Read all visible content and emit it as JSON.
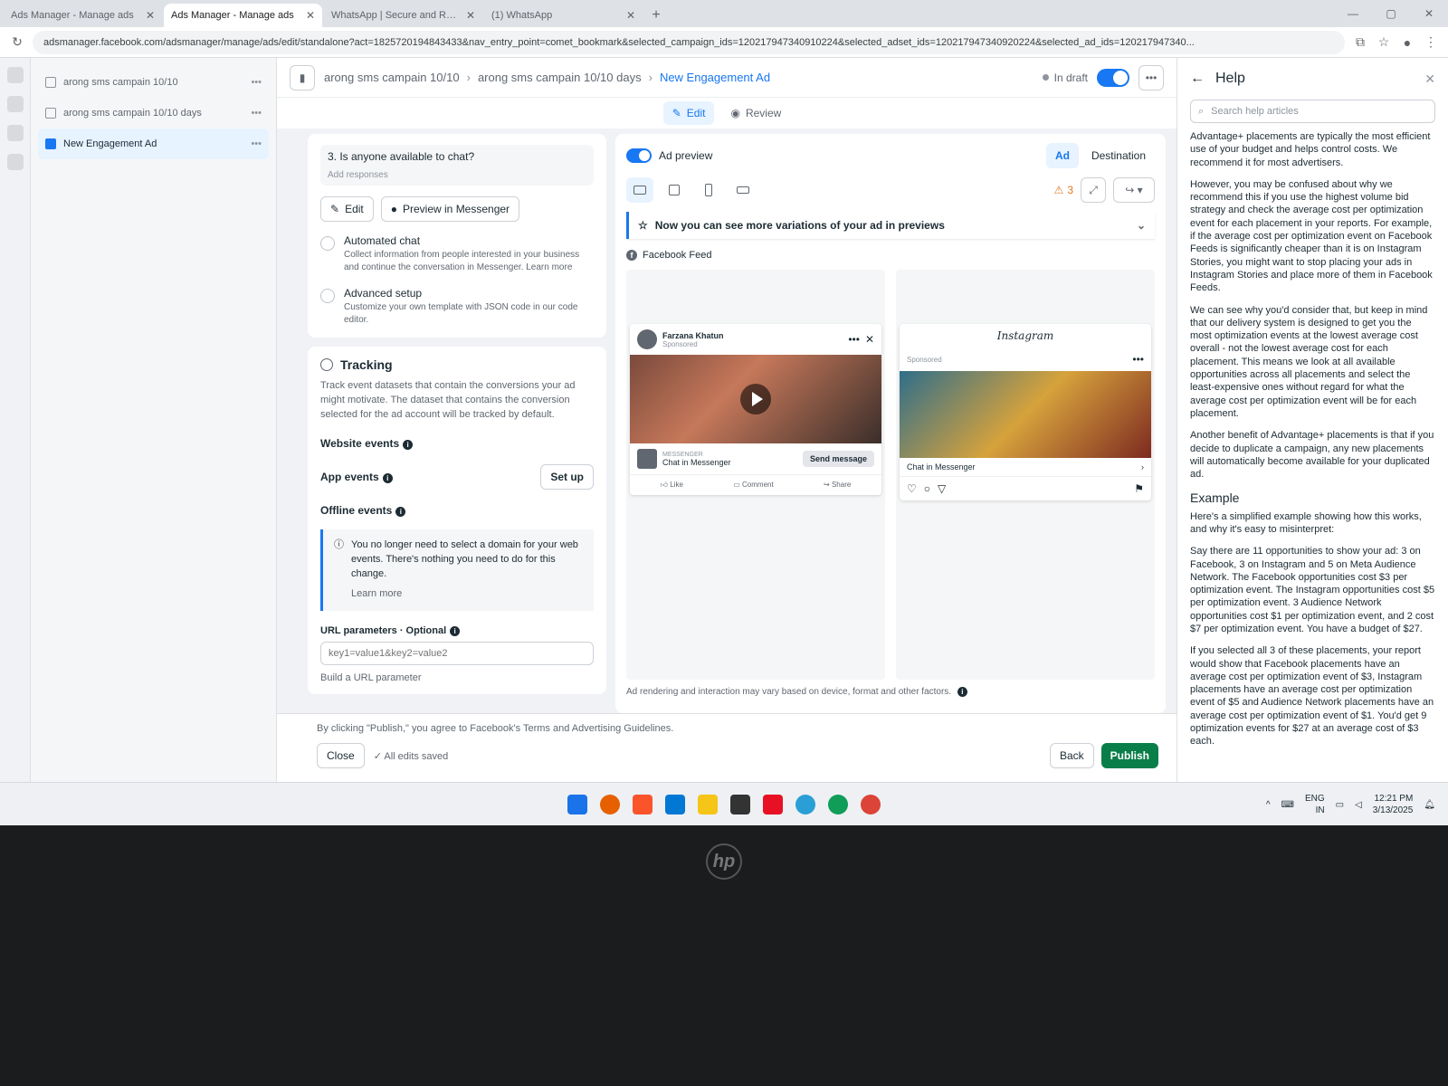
{
  "browser": {
    "tabs": [
      {
        "title": "Ads Manager - Manage ads"
      },
      {
        "title": "Ads Manager - Manage ads"
      },
      {
        "title": "WhatsApp | Secure and Reliab"
      },
      {
        "title": "(1) WhatsApp"
      }
    ],
    "url": "adsmanager.facebook.com/adsmanager/manage/ads/edit/standalone?act=1825720194843433&nav_entry_point=comet_bookmark&selected_campaign_ids=120217947340910224&selected_adset_ids=120217947340920224&selected_ad_ids=120217947340..."
  },
  "tree": {
    "items": [
      {
        "label": "arong sms campain 10/10"
      },
      {
        "label": "arong sms campain 10/10 days"
      },
      {
        "label": "New Engagement Ad"
      }
    ]
  },
  "breadcrumb": {
    "campaign": "arong sms campain 10/10",
    "adset": "arong sms campain 10/10 days",
    "ad": "New Engagement Ad"
  },
  "status": {
    "draft": "In draft"
  },
  "modes": {
    "edit": "Edit",
    "review": "Review"
  },
  "chat": {
    "question": "3. Is anyone available to chat?",
    "add_responses": "Add responses",
    "edit_btn": "Edit",
    "preview_btn": "Preview in Messenger",
    "automated_title": "Automated chat",
    "automated_desc": "Collect information from people interested in your business and continue the conversation in Messenger. Learn more",
    "advanced_title": "Advanced setup",
    "advanced_desc": "Customize your own template with JSON code in our code editor."
  },
  "tracking": {
    "title": "Tracking",
    "desc": "Track event datasets that contain the conversions your ad might motivate. The dataset that contains the conversion selected for the ad account will be tracked by default.",
    "website_events": "Website events",
    "app_events": "App events",
    "setup_btn": "Set up",
    "offline_events": "Offline events",
    "notice": "You no longer need to select a domain for your web events. There's nothing you need to do for this change.",
    "learn_more": "Learn more",
    "url_label": "URL parameters · Optional",
    "url_placeholder": "key1=value1&key2=value2",
    "build_link": "Build a URL parameter"
  },
  "preview": {
    "toggle_label": "Ad preview",
    "tab_ad": "Ad",
    "tab_destination": "Destination",
    "warnings": "3",
    "banner": "Now you can see more variations of your ad in previews",
    "placement": "Facebook Feed",
    "fb": {
      "page_name": "Farzana Khatun",
      "sponsored": "Sponsored",
      "cta_label": "MESSENGER",
      "cta_text": "Chat in Messenger",
      "cta_button": "Send message",
      "like": "Like",
      "comment": "Comment",
      "share": "Share"
    },
    "ig": {
      "brand": "Instagram",
      "sponsored": "Sponsored",
      "cta": "Chat in Messenger"
    },
    "disclaimer": "Ad rendering and interaction may vary based on device, format and other factors."
  },
  "footer": {
    "terms": "By clicking \"Publish,\" you agree to Facebook's Terms and Advertising Guidelines.",
    "close": "Close",
    "saved": "All edits saved",
    "back": "Back",
    "publish": "Publish"
  },
  "help": {
    "title": "Help",
    "search_placeholder": "Search help articles",
    "paragraphs": [
      "Advantage+ placements are typically the most efficient use of your budget and helps control costs. We recommend it for most advertisers.",
      "However, you may be confused about why we recommend this if you use the highest volume bid strategy and check the average cost per optimization event for each placement in your reports. For example, if the average cost per optimization event on Facebook Feeds is significantly cheaper than it is on Instagram Stories, you might want to stop placing your ads in Instagram Stories and place more of them in Facebook Feeds.",
      "We can see why you'd consider that, but keep in mind that our delivery system is designed to get you the most optimization events at the lowest average cost overall - not the lowest average cost for each placement. This means we look at all available opportunities across all placements and select the least-expensive ones without regard for what the average cost per optimization event will be for each placement.",
      "Another benefit of Advantage+ placements is that if you decide to duplicate a campaign, any new placements will automatically become available for your duplicated ad."
    ],
    "example_heading": "Example",
    "example_paragraphs": [
      "Here's a simplified example showing how this works, and why it's easy to misinterpret:",
      "Say there are 11 opportunities to show your ad: 3 on Facebook, 3 on Instagram and 5 on Meta Audience Network. The Facebook opportunities cost $3 per optimization event. The Instagram opportunities cost $5 per optimization event. 3 Audience Network opportunities cost $1 per optimization event, and 2 cost $7 per optimization event. You have a budget of $27.",
      "If you selected all 3 of these placements, your report would show that Facebook placements have an average cost per optimization event of $3, Instagram placements have an average cost per optimization event of $5 and Audience Network placements have an average cost per optimization event of $1. You'd get 9 optimization events for $27 at an average cost of $3 each."
    ]
  },
  "taskbar": {
    "lang": "ENG",
    "region": "IN",
    "time": "12:21 PM",
    "date": "3/13/2025"
  },
  "colors": {
    "accent": "#1877f2",
    "publish": "#0a7e49",
    "warning": "#e4791f"
  }
}
